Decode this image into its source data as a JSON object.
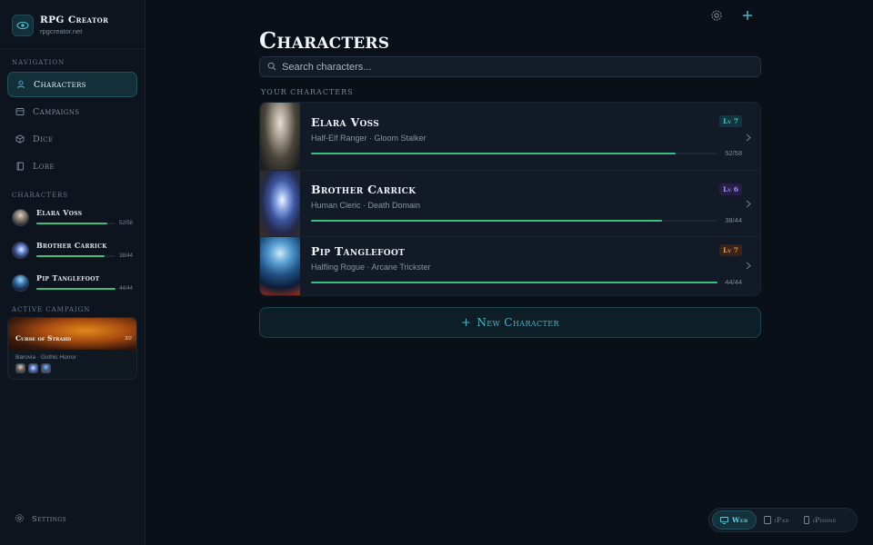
{
  "brand": {
    "title": "RPG Creator",
    "subtitle": "rpgcreator.net"
  },
  "sidebar": {
    "nav_label": "Navigation",
    "nav": [
      {
        "label": "Characters",
        "icon": "user-icon",
        "active": true
      },
      {
        "label": "Campaigns",
        "icon": "map-icon",
        "active": false
      },
      {
        "label": "Dice",
        "icon": "dice-icon",
        "active": false
      },
      {
        "label": "Lore",
        "icon": "book-icon",
        "active": false
      }
    ],
    "characters_label": "Characters",
    "characters": [
      {
        "name": "Elara Voss",
        "hp": "52/58",
        "hp_fraction": 0.9
      },
      {
        "name": "Brother Carrick",
        "hp": "38/44",
        "hp_fraction": 0.86
      },
      {
        "name": "Pip Tanglefoot",
        "hp": "44/44",
        "hp_fraction": 1.0
      }
    ],
    "campaign_label": "Active Campaign",
    "campaign": {
      "title": "Curse of Strahd",
      "count": "3/2",
      "meta": "Barovia · Gothic Horror"
    },
    "settings_label": "Settings"
  },
  "main": {
    "title": "Characters",
    "search_placeholder": "Search characters...",
    "list_label": "Your Characters",
    "characters": [
      {
        "name": "Elara Voss",
        "subtitle": "Half-Elf Ranger · Gloom Stalker",
        "level": "Lv 7",
        "hp": "52/58",
        "hp_fraction": 0.897,
        "level_color": "#3cc6d8",
        "level_bg": "#123640"
      },
      {
        "name": "Brother Carrick",
        "subtitle": "Human Cleric · Death Domain",
        "level": "Lv 6",
        "hp": "38/44",
        "hp_fraction": 0.864,
        "level_color": "#a98cf0",
        "level_bg": "#261f45"
      },
      {
        "name": "Pip Tanglefoot",
        "subtitle": "Halfling Rogue · Arcane Trickster",
        "level": "Lv 7",
        "hp": "44/44",
        "hp_fraction": 1.0,
        "level_color": "#e69a57",
        "level_bg": "#3a2215"
      }
    ],
    "new_character_label": "New Character"
  },
  "device_switch": [
    {
      "label": "Web",
      "active": true,
      "icon": "monitor-icon"
    },
    {
      "label": "iPad",
      "active": false,
      "icon": "tablet-icon"
    },
    {
      "label": "iPhone",
      "active": false,
      "icon": "phone-icon"
    }
  ],
  "colors": {
    "accent": "#46b7c9",
    "hp_green": "#3cbf7d",
    "background": "#0a1018"
  }
}
